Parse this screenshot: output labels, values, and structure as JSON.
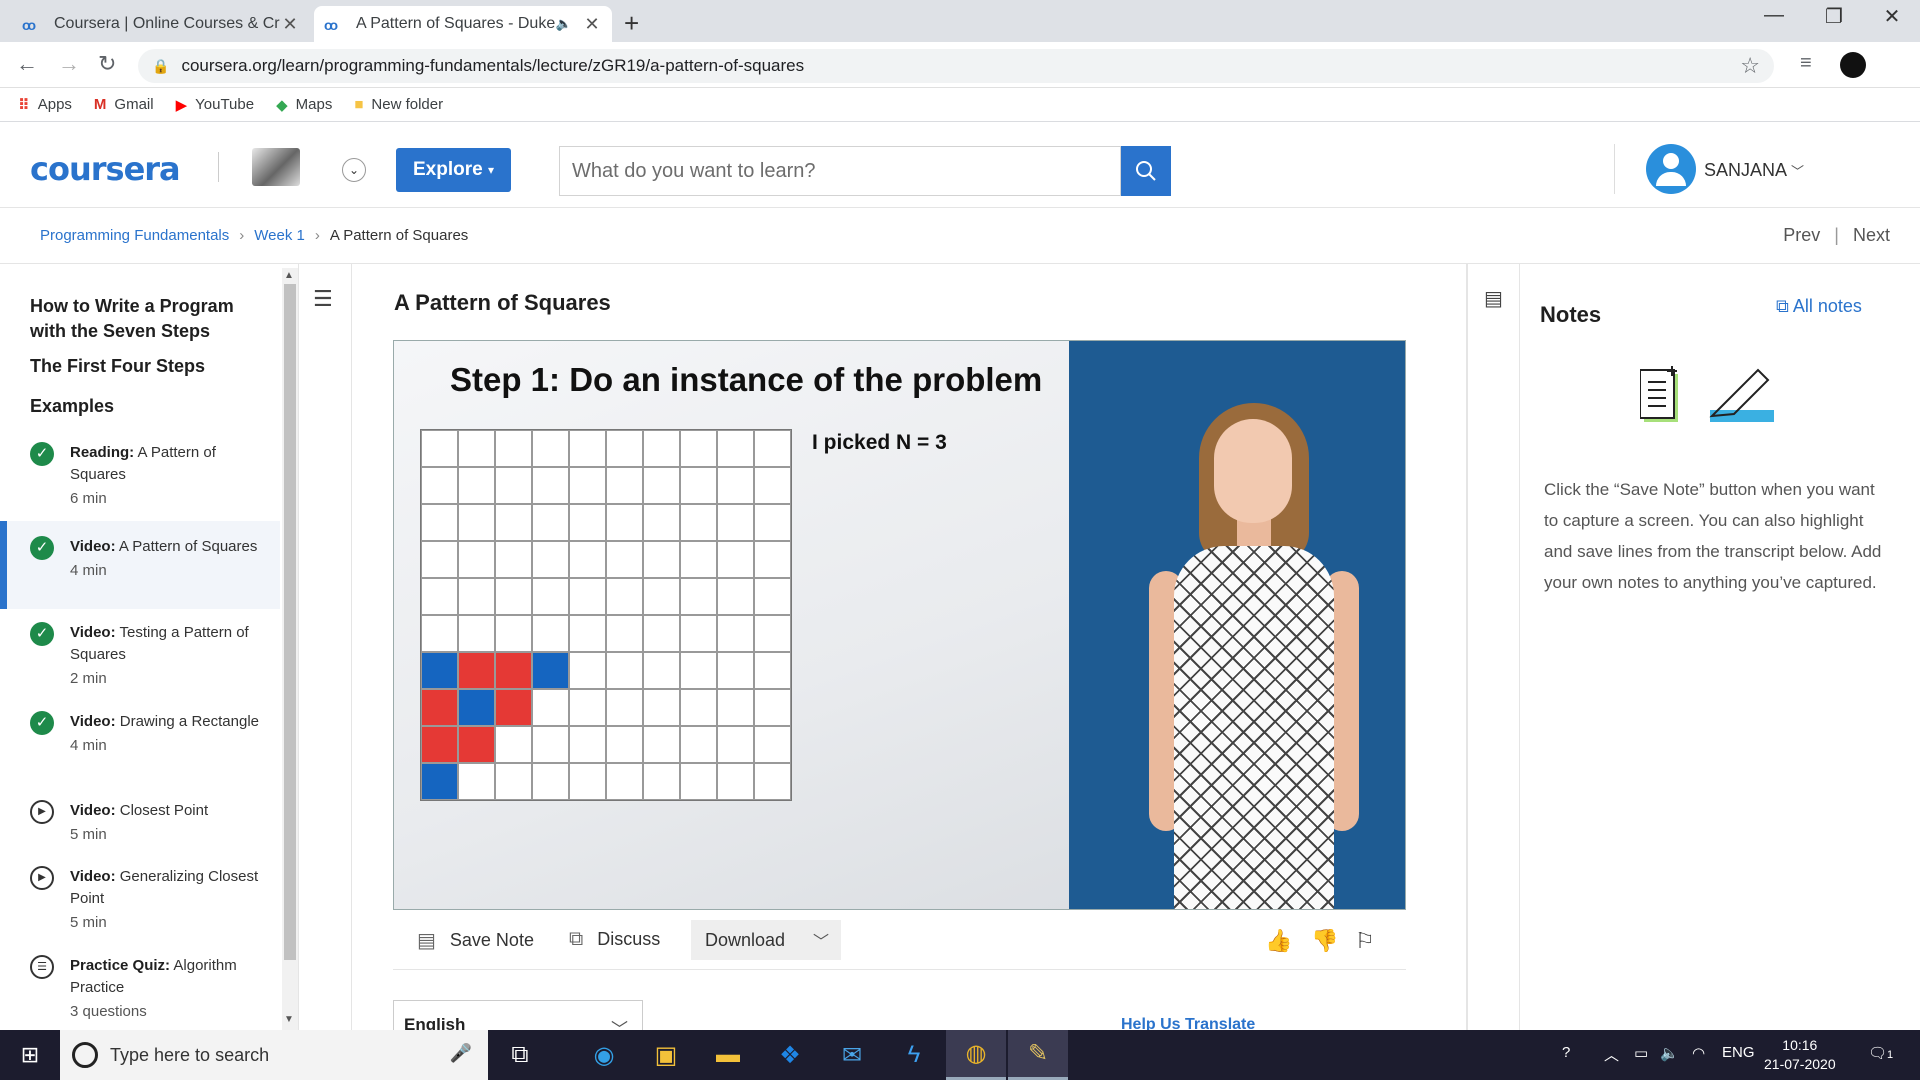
{
  "browser": {
    "tabs": [
      {
        "title": "Coursera | Online Courses & Cred",
        "active": false
      },
      {
        "title": "A Pattern of Squares - Duke",
        "active": true
      }
    ],
    "url": "coursera.org/learn/programming-fundamentals/lecture/zGR19/a-pattern-of-squares",
    "bookmarks": [
      {
        "label": "Apps",
        "icon": "apps-grid-icon"
      },
      {
        "label": "Gmail",
        "icon": "gmail-icon"
      },
      {
        "label": "YouTube",
        "icon": "youtube-icon"
      },
      {
        "label": "Maps",
        "icon": "maps-icon"
      },
      {
        "label": "New folder",
        "icon": "folder-icon"
      }
    ]
  },
  "header": {
    "logo": "coursera",
    "explore_label": "Explore",
    "search_placeholder": "What do you want to learn?",
    "username": "SANJANA",
    "accent_color": "#2a73cc"
  },
  "breadcrumb": {
    "items": [
      "Programming Fundamentals",
      "Week 1",
      "A Pattern of Squares"
    ],
    "prev": "Prev",
    "next": "Next"
  },
  "sidebar": {
    "headings": [
      "How to Write a Program with the Seven Steps",
      "The First Four Steps",
      "Examples"
    ],
    "items": [
      {
        "kind": "Reading:",
        "title": "A Pattern of Squares",
        "meta": "6 min",
        "status": "done",
        "active": false
      },
      {
        "kind": "Video:",
        "title": "A Pattern of Squares",
        "meta": "4 min",
        "status": "done",
        "active": true
      },
      {
        "kind": "Video:",
        "title": "Testing a Pattern of Squares",
        "meta": "2 min",
        "status": "done",
        "active": false
      },
      {
        "kind": "Video:",
        "title": "Drawing a Rectangle",
        "meta": "4 min",
        "status": "done",
        "active": false
      },
      {
        "kind": "Video:",
        "title": "Closest Point",
        "meta": "5 min",
        "status": "play",
        "active": false
      },
      {
        "kind": "Video:",
        "title": "Generalizing Closest Point",
        "meta": "5 min",
        "status": "play",
        "active": false
      },
      {
        "kind": "Practice Quiz:",
        "title": "Algorithm Practice",
        "meta": "3 questions",
        "status": "quiz",
        "active": false
      }
    ]
  },
  "main": {
    "title": "A Pattern of Squares",
    "slide": {
      "title": "Step 1: Do an instance of the problem",
      "note": "I picked N = 3",
      "grid_rows": [
        "..........",
        "..........",
        "..........",
        "..........",
        "..........",
        "..........",
        "BRRB......",
        "RBR.......",
        "RR........",
        "B........."
      ]
    },
    "actions": {
      "save_note": "Save Note",
      "discuss": "Discuss",
      "download": "Download"
    },
    "language": "English",
    "help_translate": "Help Us Translate"
  },
  "notes": {
    "title": "Notes",
    "all_notes": "All notes",
    "description": "Click the “Save Note” button when you want to capture a screen. You can also highlight and save lines from the transcript below. Add your own notes to anything you’ve captured."
  },
  "taskbar": {
    "search_placeholder": "Type here to search",
    "lang": "ENG",
    "time": "10:16",
    "date": "21-07-2020",
    "notification_count": "1"
  }
}
